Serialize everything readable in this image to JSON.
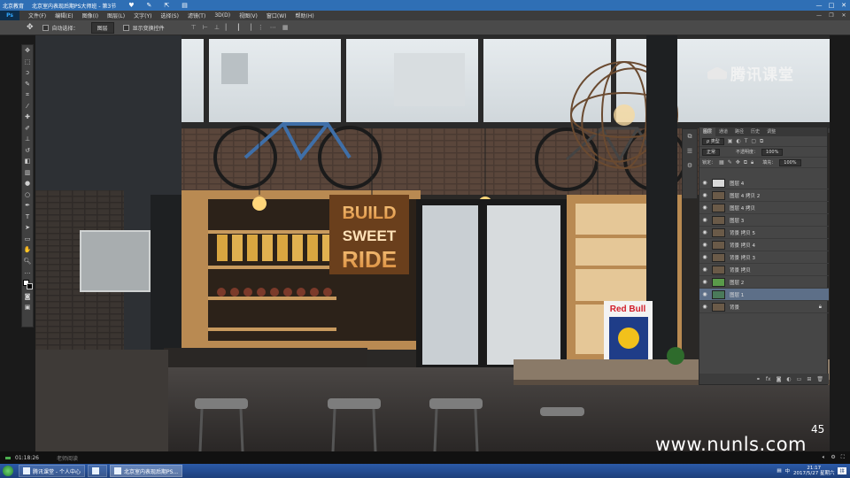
{
  "app_bar": {
    "title": "北京教育",
    "document": "北京室内表现后期PS大师班 - 第3节",
    "window_controls": [
      "—",
      "□",
      "✕"
    ]
  },
  "ps": {
    "logo": "Ps",
    "menu": [
      "文件(F)",
      "编辑(E)",
      "图像(I)",
      "图层(L)",
      "文字(Y)",
      "选择(S)",
      "滤镜(T)",
      "3D(D)",
      "视图(V)",
      "窗口(W)",
      "帮助(H)"
    ]
  },
  "options_bar": {
    "auto_select_label": "自动选择：",
    "auto_select_value": "图层",
    "show_transform_label": "显示变换控件"
  },
  "canvas": {
    "neon_line1": "BUILD",
    "neon_line2": "SWEET",
    "neon_line3": "RIDE",
    "redbull": "Red Bull"
  },
  "watermark": {
    "brand": "腾讯课堂",
    "site": "www.nunls.com",
    "counter": "45"
  },
  "layers_panel": {
    "tabs": [
      "图层",
      "通道",
      "路径",
      "历史",
      "调整"
    ],
    "filter_label": "ρ 类型",
    "blend_mode": "正常",
    "opacity_label": "不透明度：",
    "opacity_value": "100%",
    "lock_label": "锁定：",
    "fill_label": "填充：",
    "fill_value": "100%",
    "layers": [
      {
        "name": "图层 4",
        "selected": false,
        "locked": false
      },
      {
        "name": "图层 4 拷贝 2",
        "selected": false,
        "locked": false
      },
      {
        "name": "图层 4 拷贝",
        "selected": false,
        "locked": false
      },
      {
        "name": "图层 3",
        "selected": false,
        "locked": false
      },
      {
        "name": "背景 拷贝 5",
        "selected": false,
        "locked": false
      },
      {
        "name": "背景 拷贝 4",
        "selected": false,
        "locked": false
      },
      {
        "name": "背景 拷贝 3",
        "selected": false,
        "locked": false
      },
      {
        "name": "背景 拷贝",
        "selected": false,
        "locked": false
      },
      {
        "name": "图层 2",
        "selected": false,
        "locked": false
      },
      {
        "name": "图层 1",
        "selected": true,
        "locked": false
      },
      {
        "name": "背景",
        "selected": false,
        "locked": true
      }
    ]
  },
  "player": {
    "elapsed": "01:18:26",
    "teacher": "老师阅读"
  },
  "taskbar": {
    "tasks": [
      "腾讯课堂 - 个人中心",
      "北京室内表现后期PS..."
    ],
    "time": "21:17",
    "date": "2017/5/27 星期六",
    "ime": "中",
    "input_mode": "拼"
  }
}
